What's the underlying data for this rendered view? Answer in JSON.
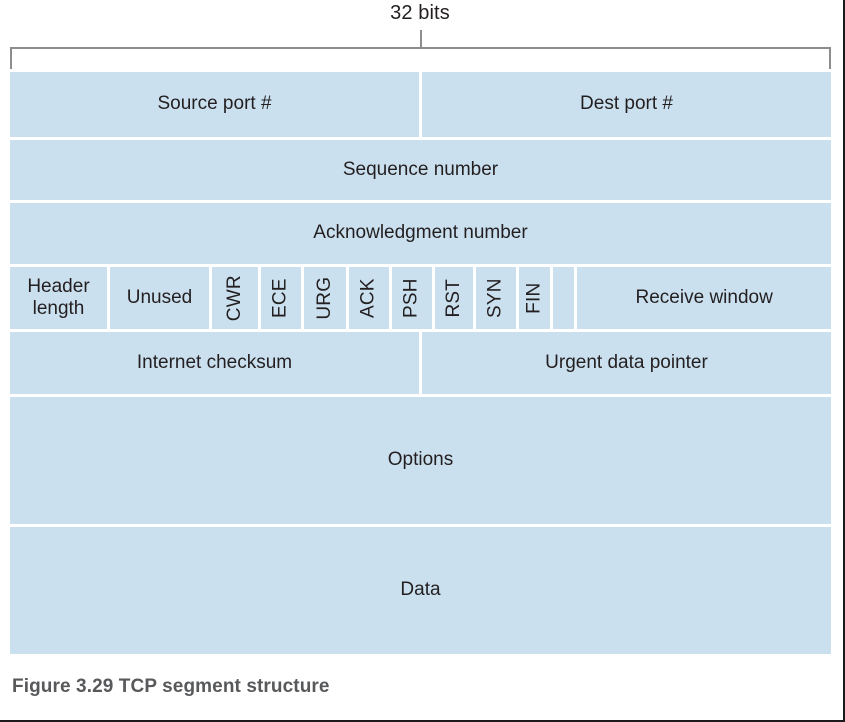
{
  "figure": {
    "width_annotation": {
      "label": "32 bits"
    },
    "caption": "Figure 3.29 TCP segment structure",
    "colors": {
      "field_fill": "#cbe0ef",
      "text": "#231f20",
      "bracket": "#8d8d8d",
      "caption_text": "#58595b",
      "page_border": "#1a1a1a",
      "background": "#ffffff"
    },
    "rows": [
      {
        "name": "ports",
        "fields": [
          {
            "label": "Source port #"
          },
          {
            "label": "Dest port #"
          }
        ]
      },
      {
        "name": "sequence",
        "fields": [
          {
            "label": "Sequence number"
          }
        ]
      },
      {
        "name": "acknowledgment",
        "fields": [
          {
            "label": "Acknowledgment number"
          }
        ]
      },
      {
        "name": "flags",
        "fields": [
          {
            "label": "Header\nlength"
          },
          {
            "label": "Unused"
          },
          {
            "label": "CWR"
          },
          {
            "label": "ECE"
          },
          {
            "label": "URG"
          },
          {
            "label": "ACK"
          },
          {
            "label": "PSH"
          },
          {
            "label": "RST"
          },
          {
            "label": "SYN"
          },
          {
            "label": "FIN"
          },
          {
            "label": ""
          },
          {
            "label": "Receive window"
          }
        ]
      },
      {
        "name": "checksum",
        "fields": [
          {
            "label": "Internet checksum"
          },
          {
            "label": "Urgent data pointer"
          }
        ]
      },
      {
        "name": "options",
        "fields": [
          {
            "label": "Options"
          }
        ]
      },
      {
        "name": "data",
        "fields": [
          {
            "label": "Data"
          }
        ]
      }
    ]
  }
}
